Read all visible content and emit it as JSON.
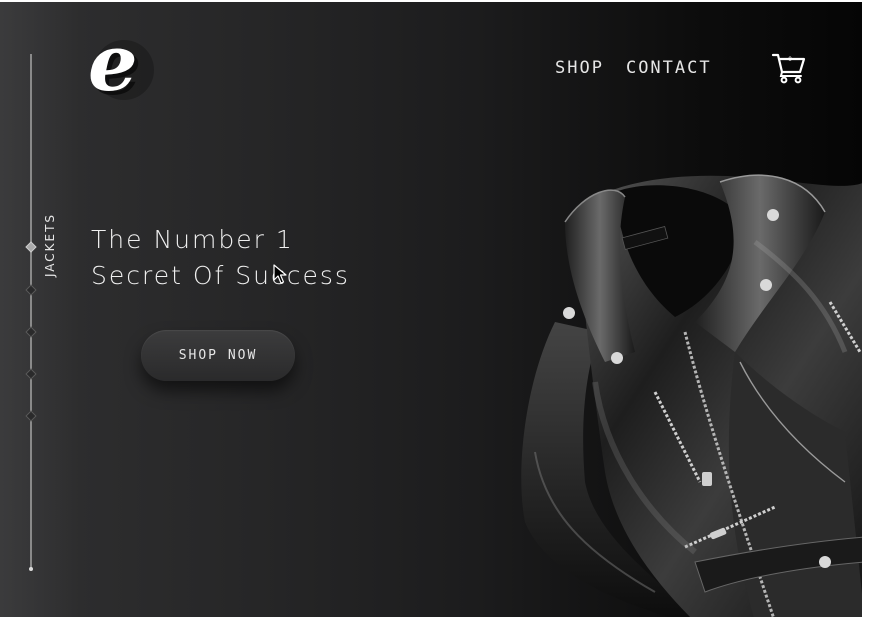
{
  "brand": {
    "logo_letter": "e"
  },
  "nav": {
    "shop_label": "SHOP",
    "contact_label": "CONTACT"
  },
  "cart": {
    "icon": "cart-icon",
    "count": "0"
  },
  "sidebar": {
    "category_label": "JACKETS",
    "slide_count": 5,
    "active_slide": 1
  },
  "hero": {
    "headline_line1": "The Number 1",
    "headline_line2": "Secret Of Success",
    "cta_label": "SHOP NOW",
    "image": "leather-jacket-image"
  },
  "colors": {
    "background_dark": "#0d0d0d",
    "background_light": "#303031",
    "text": "#e6e6e6",
    "button": "#2a2a2b"
  }
}
